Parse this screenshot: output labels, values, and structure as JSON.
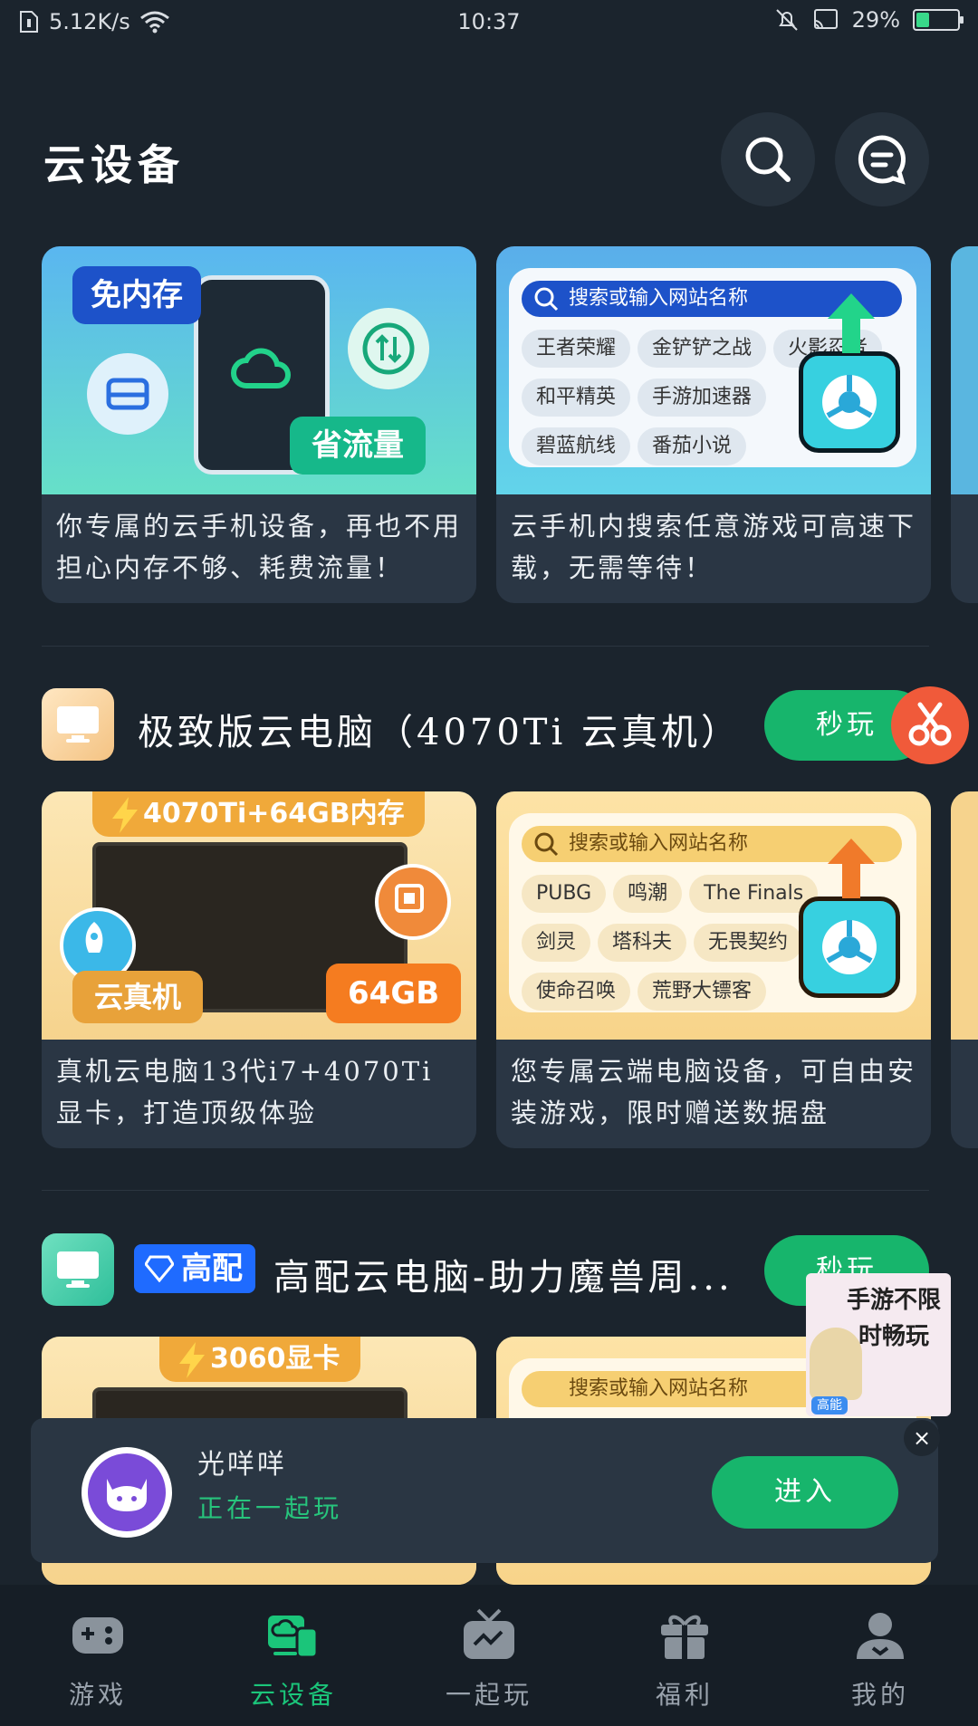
{
  "status": {
    "speed": "5.12K/s",
    "time": "10:37",
    "battery": "29%"
  },
  "header": {
    "title": "云设备"
  },
  "top_cards": [
    {
      "tag1": "免内存",
      "tag2": "省流量",
      "desc": "你专属的云手机设备，再也不用担心内存不够、耗费流量！"
    },
    {
      "search": "搜索或输入网站名称",
      "chips": [
        "王者荣耀",
        "金铲铲之战",
        "火影忍者",
        "和平精英",
        "手游加速器",
        "碧蓝航线",
        "番茄小说"
      ],
      "desc": "云手机内搜索任意游戏可高速下载，无需等待！"
    }
  ],
  "section1": {
    "title": "极致版云电脑（4070Ti 云真机）",
    "play": "秒玩",
    "cards": [
      {
        "banner": "4070Ti+64GB内存",
        "tag1": "云真机",
        "tag2": "64GB",
        "desc": "真机云电脑13代i7+4070Ti显卡，打造顶级体验"
      },
      {
        "search": "搜索或输入网站名称",
        "chips": [
          "PUBG",
          "鸣潮",
          "The Finals",
          "剑灵",
          "塔科夫",
          "无畏契约",
          "使命召唤",
          "荒野大镖客"
        ],
        "desc": "您专属云端电脑设备，可自由安装游戏，限时赠送数据盘"
      }
    ]
  },
  "section2": {
    "badge": "高配",
    "title": "高配云电脑-助力魔兽周...",
    "play": "秒玩",
    "cards": [
      {
        "banner": "3060显卡"
      },
      {
        "search": "搜索或输入网站名称"
      }
    ]
  },
  "float_ad": {
    "text": "手游不限时畅玩",
    "sub": "高能"
  },
  "now_playing": {
    "name": "光咩咩",
    "status": "正在一起玩",
    "enter": "进入",
    "close": "×"
  },
  "tabs": [
    {
      "label": "游戏",
      "icon": "gamepad-icon"
    },
    {
      "label": "云设备",
      "icon": "cloud-device-icon",
      "active": true
    },
    {
      "label": "一起玩",
      "icon": "tv-icon"
    },
    {
      "label": "福利",
      "icon": "gift-icon"
    },
    {
      "label": "我的",
      "icon": "user-icon"
    }
  ]
}
